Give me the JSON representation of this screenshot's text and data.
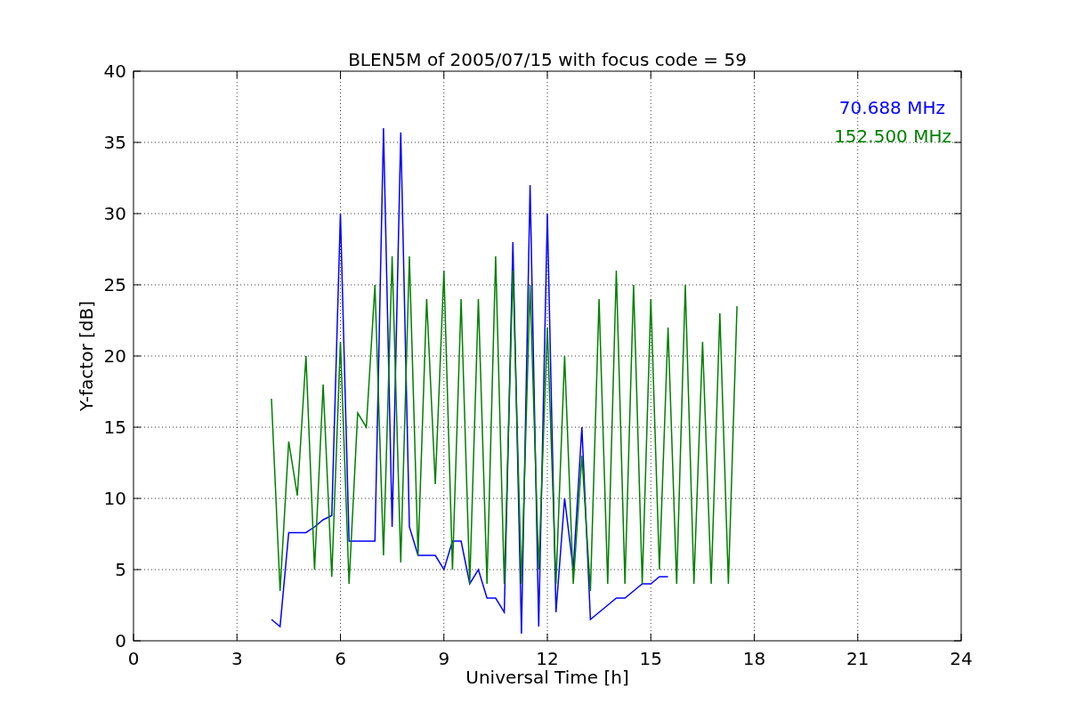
{
  "chart_data": {
    "type": "line",
    "title": "BLEN5M of 2005/07/15 with focus code = 59",
    "xlabel": "Universal Time [h]",
    "ylabel": "Y-factor [dB]",
    "x": [
      4.0,
      4.25,
      4.5,
      4.75,
      5.0,
      5.25,
      5.5,
      5.75,
      6.0,
      6.25,
      6.5,
      6.75,
      7.0,
      7.25,
      7.5,
      7.75,
      8.0,
      8.25,
      8.5,
      8.75,
      9.0,
      9.25,
      9.5,
      9.75,
      10.0,
      10.25,
      10.5,
      10.75,
      11.0,
      11.25,
      11.5,
      11.75,
      12.0,
      12.25,
      12.5,
      12.75,
      13.0,
      13.25,
      13.5,
      13.75,
      14.0,
      14.25,
      14.5,
      14.75,
      15.0,
      15.25,
      15.5,
      15.75,
      16.0,
      16.25,
      16.5,
      16.75,
      17.0,
      17.25,
      17.5
    ],
    "series": [
      {
        "name": "70.688 MHz",
        "color": "#0000ff",
        "values": [
          1.5,
          1,
          7.6,
          7.6,
          7.6,
          8,
          8.5,
          8.8,
          30,
          7,
          7,
          7,
          7,
          36,
          8,
          35.7,
          8,
          6,
          6,
          6,
          5,
          7,
          7,
          4,
          5,
          3,
          3,
          2,
          28,
          0.5,
          32,
          1,
          30,
          2,
          10,
          5,
          15,
          1.5,
          2,
          2.5,
          3,
          3,
          3.5,
          4,
          4,
          4.5,
          4.5,
          null,
          null,
          null,
          null,
          null,
          null,
          null,
          null
        ]
      },
      {
        "name": "152.500 MHz",
        "color": "#008000",
        "values": [
          17,
          3.5,
          14,
          10.2,
          20,
          5,
          18,
          4.5,
          21,
          4,
          16,
          15,
          25,
          6,
          27,
          5.5,
          27,
          6,
          24,
          11,
          26,
          5,
          24,
          4,
          24,
          4,
          27,
          4,
          26,
          4,
          25,
          5,
          22,
          4,
          20,
          4,
          13,
          3.5,
          24,
          4,
          26,
          4,
          25,
          4,
          24,
          5,
          22,
          4,
          25,
          4,
          21,
          4,
          23,
          4,
          23.5
        ]
      }
    ],
    "grid": true,
    "xlim": [
      0,
      24
    ],
    "ylim": [
      0,
      40
    ],
    "xticks": [
      0,
      3,
      6,
      9,
      12,
      15,
      18,
      21,
      24
    ],
    "yticks": [
      0,
      5,
      10,
      15,
      20,
      25,
      30,
      35,
      40
    ]
  }
}
